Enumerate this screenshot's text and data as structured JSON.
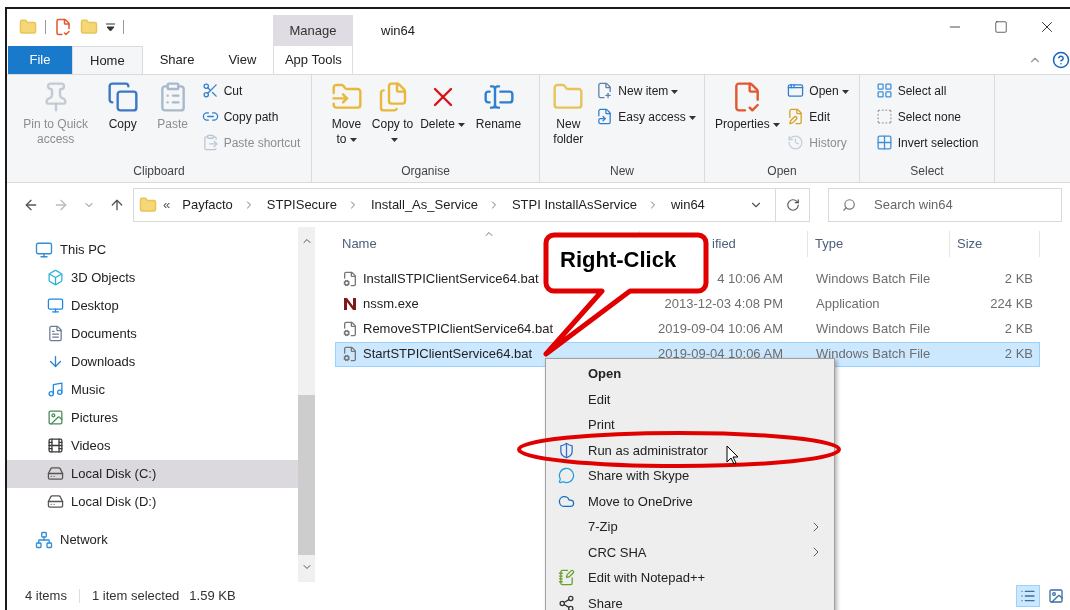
{
  "window": {
    "title": "win64"
  },
  "contextual_tab_header": "Manage",
  "ribbon_tabs": [
    {
      "label": "File",
      "kind": "file",
      "selected": false
    },
    {
      "label": "Home",
      "kind": "tab",
      "selected": true
    },
    {
      "label": "Share",
      "kind": "tab",
      "selected": false
    },
    {
      "label": "View",
      "kind": "tab",
      "selected": false
    },
    {
      "label": "App Tools",
      "kind": "tab",
      "selected": false
    }
  ],
  "ribbon_groups": [
    {
      "label": "Clipboard",
      "buttons": [
        {
          "label": "Pin to Quick access",
          "kind": "large",
          "disabled": true,
          "dropdown": false
        },
        {
          "label": "Copy",
          "kind": "large",
          "disabled": false,
          "dropdown": false
        },
        {
          "label": "Paste",
          "kind": "large",
          "disabled": true,
          "dropdown": false
        },
        {
          "label": "Cut",
          "kind": "small",
          "disabled": false,
          "dropdown": false
        },
        {
          "label": "Copy path",
          "kind": "small",
          "disabled": false,
          "dropdown": false
        },
        {
          "label": "Paste shortcut",
          "kind": "small",
          "disabled": true,
          "dropdown": false
        }
      ]
    },
    {
      "label": "Organise",
      "buttons": [
        {
          "label": "Move to",
          "kind": "large",
          "disabled": false,
          "dropdown": true
        },
        {
          "label": "Copy to",
          "kind": "large",
          "disabled": false,
          "dropdown": true
        },
        {
          "label": "Delete",
          "kind": "large",
          "disabled": false,
          "dropdown": true
        },
        {
          "label": "Rename",
          "kind": "large",
          "disabled": false,
          "dropdown": false
        }
      ]
    },
    {
      "label": "New",
      "buttons": [
        {
          "label": "New folder",
          "kind": "large",
          "disabled": false,
          "dropdown": false
        },
        {
          "label": "New item",
          "kind": "small",
          "disabled": false,
          "dropdown": true
        },
        {
          "label": "Easy access",
          "kind": "small",
          "disabled": false,
          "dropdown": true
        }
      ]
    },
    {
      "label": "Open",
      "buttons": [
        {
          "label": "Properties",
          "kind": "large",
          "disabled": false,
          "dropdown": true
        },
        {
          "label": "Open",
          "kind": "small",
          "disabled": false,
          "dropdown": true
        },
        {
          "label": "Edit",
          "kind": "small",
          "disabled": false,
          "dropdown": false
        },
        {
          "label": "History",
          "kind": "small",
          "disabled": true,
          "dropdown": false
        }
      ]
    },
    {
      "label": "Select",
      "buttons": [
        {
          "label": "Select all",
          "kind": "small",
          "disabled": false,
          "dropdown": false
        },
        {
          "label": "Select none",
          "kind": "small",
          "disabled": false,
          "dropdown": false
        },
        {
          "label": "Invert selection",
          "kind": "small",
          "disabled": false,
          "dropdown": false
        }
      ]
    }
  ],
  "address_bar": {
    "overflow_marker": "«",
    "breadcrumbs": [
      "Payfacto",
      "STPISecure",
      "Install_As_Service",
      "STPI InstallAsService",
      "win64"
    ]
  },
  "search": {
    "placeholder": "Search win64"
  },
  "sidebar": {
    "items": [
      {
        "label": "This PC",
        "selected": false,
        "children": [
          {
            "label": "3D Objects",
            "selected": false
          },
          {
            "label": "Desktop",
            "selected": false
          },
          {
            "label": "Documents",
            "selected": false
          },
          {
            "label": "Downloads",
            "selected": false
          },
          {
            "label": "Music",
            "selected": false
          },
          {
            "label": "Pictures",
            "selected": false
          },
          {
            "label": "Videos",
            "selected": false
          },
          {
            "label": "Local Disk (C:)",
            "selected": true
          },
          {
            "label": "Local Disk (D:)",
            "selected": false
          }
        ]
      },
      {
        "label": "Network",
        "selected": false
      }
    ]
  },
  "file_list": {
    "columns": [
      "Name",
      "ified",
      "Type",
      "Size"
    ],
    "rows": [
      {
        "name": "InstallSTPIClientService64.bat",
        "date": "4 10:06 AM",
        "type": "Windows Batch File",
        "size": "2 KB",
        "selected": false
      },
      {
        "name": "nssm.exe",
        "date": "2013-12-03 4:08 PM",
        "type": "Application",
        "size": "224 KB",
        "selected": false
      },
      {
        "name": "RemoveSTPIClientService64.bat",
        "date": "2019-09-04 10:06 AM",
        "type": "Windows Batch File",
        "size": "2 KB",
        "selected": false
      },
      {
        "name": "StartSTPIClientService64.bat",
        "date": "2019-09-04 10:06 AM",
        "type": "Windows Batch File",
        "size": "2 KB",
        "selected": true
      }
    ]
  },
  "context_menu": [
    {
      "label": "Open",
      "default": true,
      "submenu": false
    },
    {
      "label": "Edit",
      "default": false,
      "submenu": false
    },
    {
      "label": "Print",
      "default": false,
      "submenu": false
    },
    {
      "label": "Run as administrator",
      "default": false,
      "submenu": false
    },
    {
      "label": "Share with Skype",
      "default": false,
      "submenu": false
    },
    {
      "label": "Move to OneDrive",
      "default": false,
      "submenu": false
    },
    {
      "label": "7-Zip",
      "default": false,
      "submenu": true
    },
    {
      "label": "CRC SHA",
      "default": false,
      "submenu": true
    },
    {
      "label": "Edit with Notepad++",
      "default": false,
      "submenu": false
    },
    {
      "label": "Share",
      "default": false,
      "submenu": false
    }
  ],
  "callout": {
    "text": "Right-Click"
  },
  "status_bar": {
    "item_count": "4 items",
    "selection": "1 item selected",
    "selection_size": "1.59 KB"
  },
  "view_buttons": [
    {
      "selected": true
    },
    {
      "selected": false
    }
  ]
}
